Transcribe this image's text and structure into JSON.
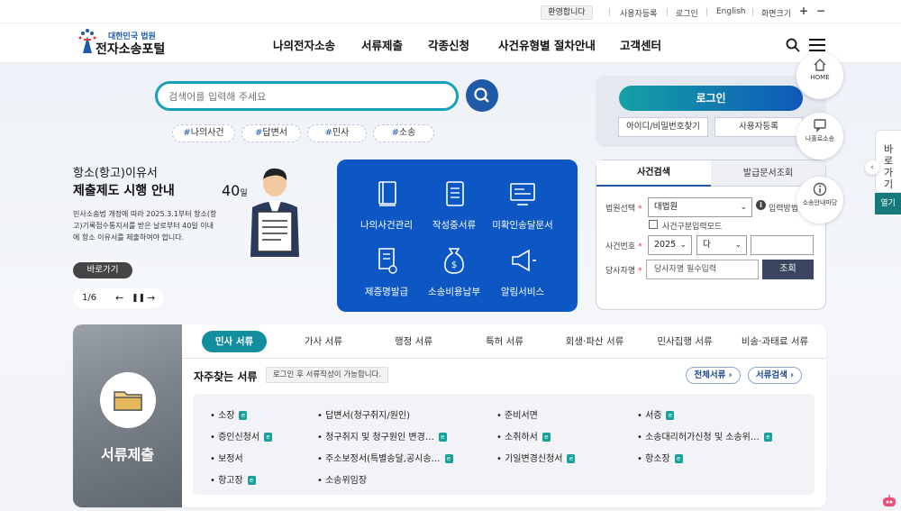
{
  "topbar": {
    "welcome": "환영합니다",
    "links": [
      "사용자등록",
      "로그인",
      "English"
    ],
    "font_size_label": "화면크기",
    "plus": "+",
    "minus": "−"
  },
  "header": {
    "logo_sub": "대한민국 법원",
    "logo_title": "전자소송포털",
    "nav": [
      "나의전자소송",
      "서류제출",
      "각종신청",
      "사건유형별 절차안내",
      "고객센터"
    ],
    "icons": [
      "search-icon",
      "menu-icon"
    ]
  },
  "search": {
    "placeholder": "검색어를 입력해 주세요",
    "tags": [
      {
        "hash": "#",
        "text": "나의사건"
      },
      {
        "hash": "#",
        "text": "답변서"
      },
      {
        "hash": "#",
        "text": "민사"
      },
      {
        "hash": "#",
        "text": "소송"
      }
    ]
  },
  "banner": {
    "title1": "항소(항고)이유서",
    "title2": "제출제도 시행 안내",
    "body": "민사소송법 개정에 따라 2025.3.1부터 항소(항고)기록접수통지서를 받은 날로부터 40일 이내에 항소 이유서를 제출하여야 합니다.",
    "go_button": "바로가기",
    "page": "1/6",
    "badge_number": "40",
    "badge_unit": "일"
  },
  "quick_menu": [
    {
      "label": "나의사건관리",
      "icon": "book-icon"
    },
    {
      "label": "작성중서류",
      "icon": "notebook-icon"
    },
    {
      "label": "미확인송달문서",
      "icon": "monitor-icon"
    },
    {
      "label": "제증명발급",
      "icon": "certificate-icon"
    },
    {
      "label": "소송비용납부",
      "icon": "money-bag-icon"
    },
    {
      "label": "알림서비스",
      "icon": "megaphone-icon"
    }
  ],
  "login": {
    "login_button": "로그인",
    "find_button": "아이디/비밀번호찾기",
    "register_button": "사용자등록"
  },
  "case_search": {
    "tabs": [
      "사건검색",
      "발급문서조회"
    ],
    "court_label": "법원선택",
    "court_value": "대법원",
    "input_method": "입력방법",
    "checkbox_label": "사건구분입력모드",
    "case_no_label": "사건번호",
    "year_value": "2025",
    "type_value": "다",
    "party_label": "당사자명",
    "party_placeholder": "당사자명 필수입력",
    "query_button": "조회",
    "required_mark": "*"
  },
  "floating": [
    {
      "label": "HOME",
      "icon": "home-icon"
    },
    {
      "label": "나홀로소송",
      "icon": "chat-icon"
    },
    {
      "label": "소송안내마당",
      "icon": "info-icon"
    }
  ],
  "side_tab": {
    "label": "바로가기",
    "open": "열기",
    "arrow": "‹"
  },
  "documents": {
    "photo_title": "서류제출",
    "tabs": [
      "민사 서류",
      "가사 서류",
      "행정 서류",
      "특허 서류",
      "회생·파산 서류",
      "민사집행 서류",
      "비송·과태료 서류"
    ],
    "active_tab": 0,
    "frequent_title": "자주찾는 서류",
    "login_note": "로그인 후 서류작성이 가능합니다.",
    "all_button": "전체서류 ›",
    "search_button": "서류검색 ›",
    "columns": [
      [
        {
          "text": "소장",
          "e": true
        },
        {
          "text": "증인신청서",
          "e": true
        },
        {
          "text": "보정서",
          "e": false
        },
        {
          "text": "항고장",
          "e": true
        }
      ],
      [
        {
          "text": "답변서(청구취지/원인)",
          "e": false
        },
        {
          "text": "청구취지 및 청구원인 변경…",
          "e": true
        },
        {
          "text": "주소보정서(특별송달,공시송…",
          "e": true
        },
        {
          "text": "소송위임장",
          "e": false
        }
      ],
      [
        {
          "text": "준비서면",
          "e": false
        },
        {
          "text": "소취하서",
          "e": true
        },
        {
          "text": "기일변경신청서",
          "e": true
        }
      ],
      [
        {
          "text": "서증",
          "e": true
        },
        {
          "text": "소송대리허가신청 및 소송위…",
          "e": true
        },
        {
          "text": "항소장",
          "e": true
        }
      ]
    ]
  },
  "colors": {
    "brand_blue": "#1e5aa8",
    "teal": "#138e9e",
    "quick_blue": "#0d57c5"
  }
}
